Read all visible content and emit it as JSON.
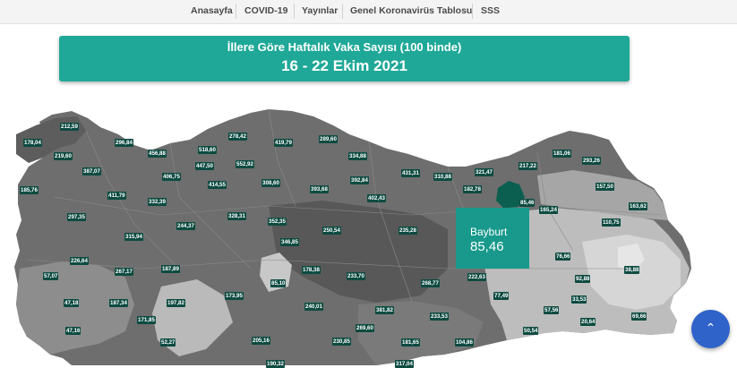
{
  "nav": {
    "items": [
      "Anasayfa",
      "COVID-19",
      "Yayınlar",
      "Genel Koronavirüs Tablosu",
      "SSS"
    ]
  },
  "banner": {
    "title": "İllere Göre Haftalık Vaka Sayısı (100 binde)",
    "date": "16 - 22 Ekim 2021"
  },
  "map": {
    "labels": [
      "212,59",
      "178,04",
      "296,84",
      "219,60",
      "456,88",
      "518,60",
      "278,42",
      "419,79",
      "289,60",
      "334,88",
      "181,06",
      "293,26",
      "387,07",
      "447,50",
      "406,75",
      "552,92",
      "431,31",
      "310,88",
      "321,47",
      "217,22",
      "185,76",
      "414,55",
      "308,60",
      "393,68",
      "392,84",
      "182,78",
      "157,50",
      "411,79",
      "402,43",
      "85,46",
      "163,62",
      "332,39",
      "328,31",
      "165,24",
      "297,35",
      "244,37",
      "352,35",
      "235,28",
      "110,75",
      "315,94",
      "250,54",
      "346,85",
      "226,64",
      "178,38",
      "76,66",
      "57,07",
      "267,17",
      "187,89",
      "233,70",
      "268,77",
      "222,63",
      "92,88",
      "38,88",
      "85,10",
      "173,95",
      "47,18",
      "187,34",
      "197,82",
      "240,01",
      "381,82",
      "77,49",
      "33,53",
      "57,56",
      "69,66",
      "171,85",
      "233,53",
      "269,60",
      "20,64",
      "47,16",
      "50,54",
      "52,27",
      "205,16",
      "230,85",
      "181,65",
      "104,86",
      "190,32",
      "317,04"
    ],
    "colors": {
      "sea": "#ffffff",
      "dark": "#616161",
      "mid": "#7e7e7e",
      "light": "#9c9c9c",
      "lighter": "#bdbdbd",
      "lightest": "#dcdcdc",
      "highlight": "#0a5f50",
      "label_bg": "#0d4b41"
    }
  },
  "tooltip": {
    "name": "Bayburt",
    "value": "85,46"
  },
  "fab": {
    "icon": "chevron-up-icon",
    "glyph": "⌃"
  }
}
